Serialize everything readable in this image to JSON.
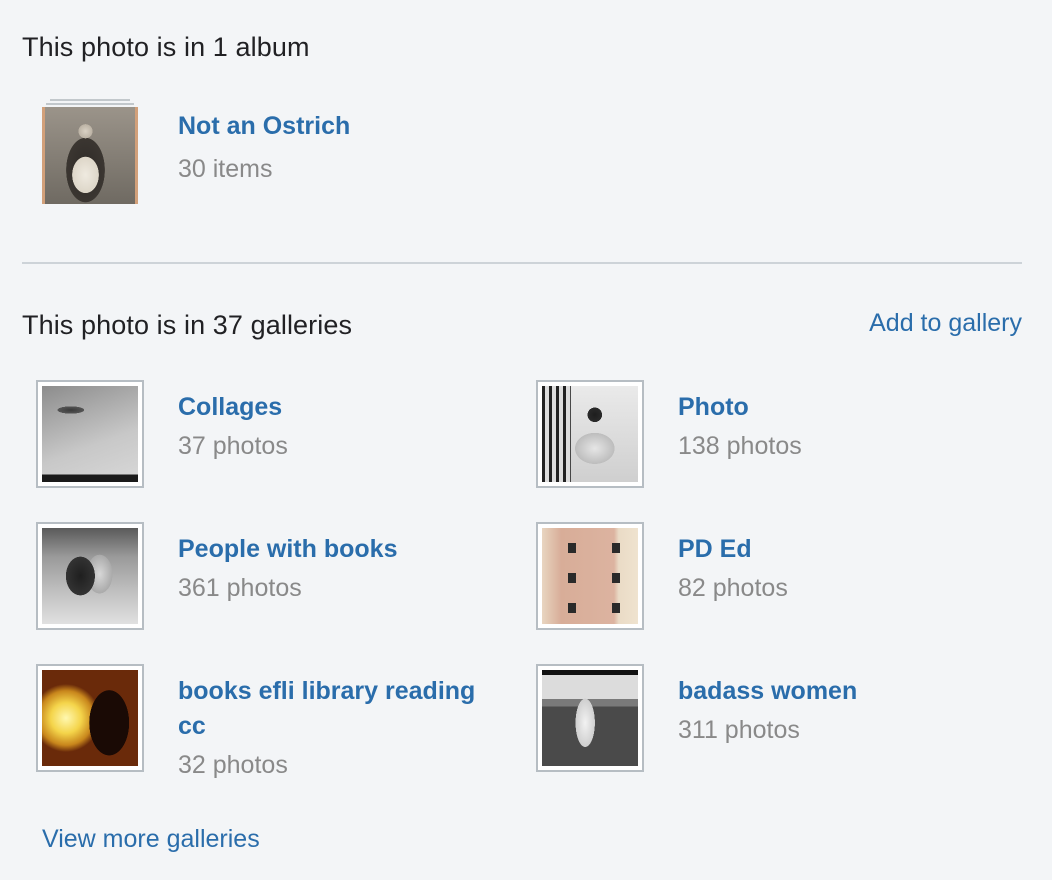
{
  "albums_section": {
    "title": "This photo is in 1 album",
    "albums": [
      {
        "name": "Not an Ostrich",
        "count": "30 items",
        "thumbnail": "woman-with-ostrich-photo"
      }
    ]
  },
  "galleries_section": {
    "title": "This photo is in 37 galleries",
    "add_label": "Add to gallery",
    "galleries": [
      {
        "name": "Collages",
        "count": "37 photos",
        "thumbnail": "diver-photo"
      },
      {
        "name": "Photo",
        "count": "138 photos",
        "thumbnail": "woman-seated-photo"
      },
      {
        "name": "People with books",
        "count": "361 photos",
        "thumbnail": "people-on-bench-photo"
      },
      {
        "name": "PD Ed",
        "count": "82 photos",
        "thumbnail": "building-facade-drawing"
      },
      {
        "name": "books efli library reading cc",
        "count": "32 photos",
        "thumbnail": "reader-by-lamp-photo"
      },
      {
        "name": "badass women",
        "count": "311 photos",
        "thumbnail": "woman-baseball-photo"
      }
    ],
    "view_more_label": "View more galleries"
  },
  "colors": {
    "link": "#2a6dab",
    "muted": "#898989",
    "background": "#f3f5f7"
  }
}
